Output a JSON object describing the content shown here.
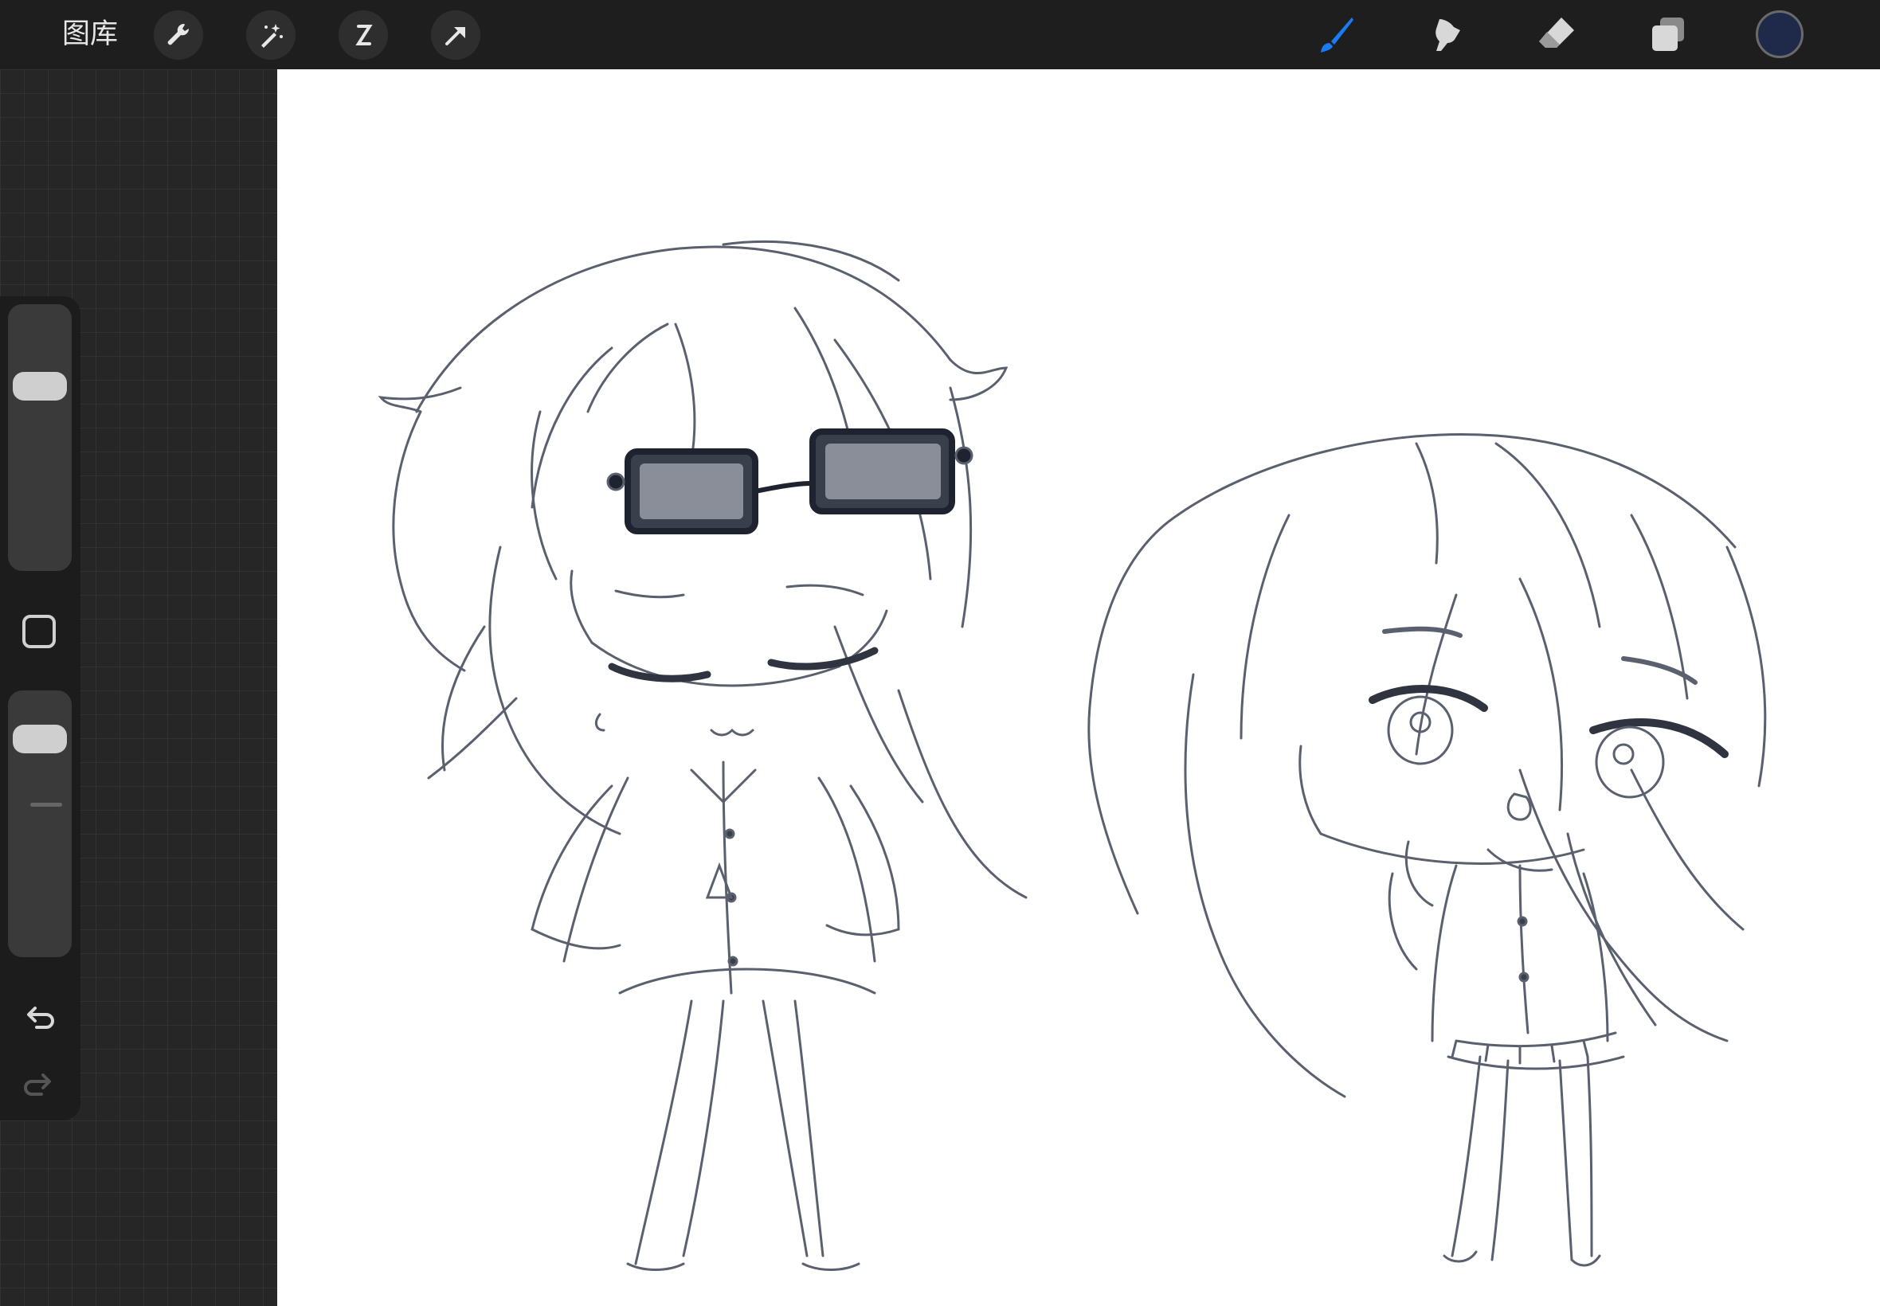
{
  "toolbar": {
    "gallery_label": "图库",
    "left_tools": [
      "wrench-icon",
      "magic-wand-icon",
      "selection-icon",
      "transform-arrow-icon"
    ],
    "right_tools": [
      "brush-icon",
      "smudge-icon",
      "eraser-icon",
      "layers-icon"
    ],
    "active_tool": "brush",
    "active_color": "#1f2a4a",
    "accent_color": "#1a7cf5"
  },
  "sidebar": {
    "brush_size_level": 0.27,
    "opacity_level": 0.88,
    "undo_icon": "undo-icon",
    "redo_icon": "redo-icon",
    "modify_icon": "square-icon"
  }
}
